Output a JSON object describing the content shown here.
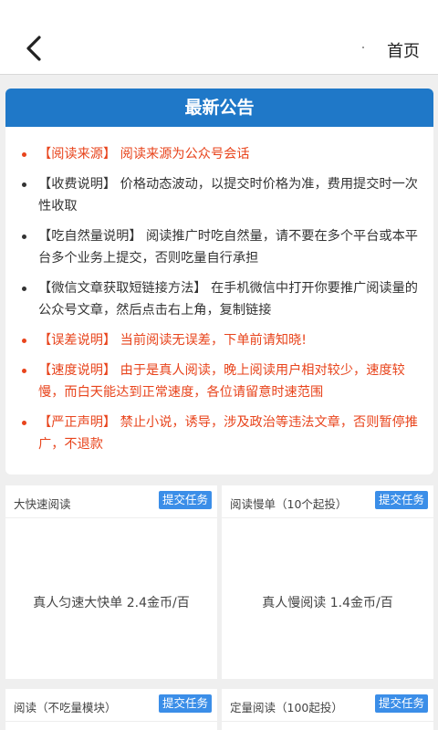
{
  "header": {
    "back_icon": "chevron-left-icon",
    "home_label": "首页"
  },
  "notice": {
    "title": "最新公告",
    "items": [
      {
        "text": "【阅读来源】 阅读来源为公众号会话",
        "color": "#e8441c"
      },
      {
        "text": "【收费说明】 价格动态波动，以提交时价格为准，费用提交时一次性收取",
        "color": "#333333"
      },
      {
        "text": "【吃自然量说明】 阅读推广时吃自然量，请不要在多个平台或本平台多个业务上提交，否则吃量自行承担",
        "color": "#333333"
      },
      {
        "text": "【微信文章获取短链接方法】 在手机微信中打开你要推广阅读量的公众号文章，然后点击右上角，复制链接",
        "color": "#333333"
      },
      {
        "text": "【误差说明】 当前阅读无误差，下单前请知晓!",
        "color": "#e8441c"
      },
      {
        "text": "【速度说明】 由于是真人阅读，晚上阅读用户相对较少，速度较慢，而白天能达到正常速度，各位请留意时速范围",
        "color": "#e8441c"
      },
      {
        "text": "【严正声明】 禁止小说，诱导，涉及政治等违法文章，否则暂停推广，不退款",
        "color": "#e8441c"
      }
    ],
    "header_color": "#1f78c8"
  },
  "cards": [
    {
      "title": "大快速阅读",
      "button": "提交任务",
      "body": "真人匀速大快单 2.4金币/百"
    },
    {
      "title": "阅读慢单（10个起投）",
      "button": "提交任务",
      "body": "真人慢阅读 1.4金币/百"
    },
    {
      "title": "阅读（不吃量模块）",
      "button": "提交任务",
      "body": ""
    },
    {
      "title": "定量阅读（100起投）",
      "button": "提交任务",
      "body": ""
    }
  ],
  "colors": {
    "accent": "#3b8ee8",
    "warning": "#e8441c"
  }
}
